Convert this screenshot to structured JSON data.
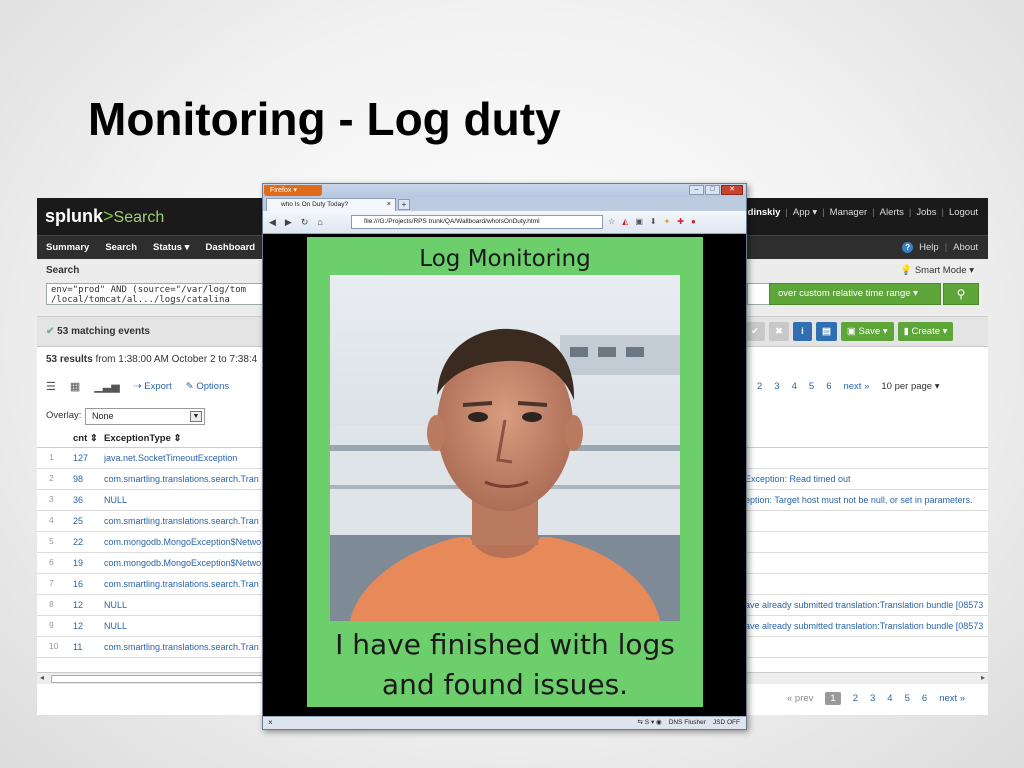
{
  "slide": {
    "title": "Monitoring - Log duty"
  },
  "splunk": {
    "logo_text": "splunk",
    "logo_arrow": ">",
    "logo_app": "Search",
    "user_menu": [
      "udinskiy",
      "App",
      "Manager",
      "Alerts",
      "Jobs",
      "Logout"
    ],
    "nav": [
      "Summary",
      "Search",
      "Status",
      "Dashboard"
    ],
    "help": [
      "Help",
      "About"
    ],
    "search_label": "Search",
    "smart_mode": "Smart Mode",
    "query_line1": "env=\"prod\" AND (source=\"/var/log/tom",
    "query_line2": "/local/tomcat/al.../logs/catalina",
    "time_range": "over custom relative time range",
    "matching_events": "53 matching events",
    "results_count": "53 results",
    "results_range": "from 1:38:00 AM October 2 to 7:38:4",
    "view_export": "Export",
    "view_options": "Options",
    "pager_top": [
      "2",
      "3",
      "4",
      "5",
      "6",
      "next »"
    ],
    "per_page": "10 per page",
    "overlay_label": "Overlay:",
    "overlay_value": "None",
    "save_label": "Save",
    "create_label": "Create",
    "columns": {
      "cnt": "cnt",
      "type": "ExceptionType"
    },
    "rows": [
      {
        "n": "1",
        "cnt": "127",
        "type": "java.net.SocketTimeoutException",
        "msg": ""
      },
      {
        "n": "2",
        "cnt": "98",
        "type": "com.smartling.translations.search.Tran",
        "msg": "Exception: Read timed out"
      },
      {
        "n": "3",
        "cnt": "36",
        "type": "NULL",
        "msg": "eption: Target host must not be null, or set in parameters."
      },
      {
        "n": "4",
        "cnt": "25",
        "type": "com.smartling.translations.search.Tran",
        "msg": ""
      },
      {
        "n": "5",
        "cnt": "22",
        "type": "com.mongodb.MongoException$Netwo",
        "msg": ""
      },
      {
        "n": "6",
        "cnt": "19",
        "type": "com.mongodb.MongoException$Netwo",
        "msg": ""
      },
      {
        "n": "7",
        "cnt": "16",
        "type": "com.smartling.translations.search.Tran",
        "msg": ""
      },
      {
        "n": "8",
        "cnt": "12",
        "type": "NULL",
        "msg": "ave already submitted translation:Translation bundle [08573"
      },
      {
        "n": "9",
        "cnt": "12",
        "type": "NULL",
        "msg": "ave already submitted translation:Translation bundle [08573"
      },
      {
        "n": "10",
        "cnt": "11",
        "type": "com.smartling.translations.search.Tran",
        "msg": ""
      }
    ],
    "pager_bottom": {
      "prev": "« prev",
      "current": "1",
      "pages": [
        "2",
        "3",
        "4",
        "5",
        "6"
      ],
      "next": "next »"
    }
  },
  "firefox": {
    "menu_label": "Firefox",
    "tab_title": "who Is On Duty Today?",
    "url": "file:///G:/Projects/RPS trunk/QA/Wallboard/whoIsOnDuty.html",
    "status_items": [
      "DNS Flusher",
      "JSD OFF"
    ]
  },
  "poster": {
    "title": "Log Monitoring",
    "caption_line1": "I have finished with logs",
    "caption_line2": "and found issues."
  },
  "colors": {
    "poster_bg": "#6ccf6c",
    "splunk_green": "#5ea63a",
    "link_blue": "#2a64a8"
  }
}
